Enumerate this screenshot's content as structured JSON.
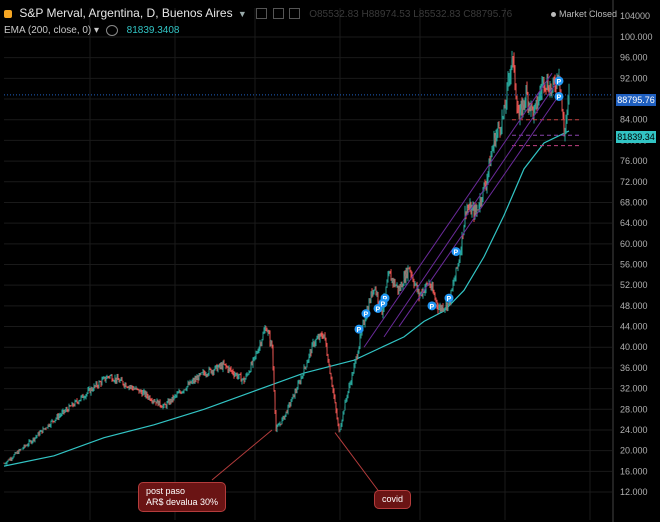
{
  "header": {
    "symbol_title": "S&P Merval, Argentina, D, Buenos Aires",
    "ohlc": "O85532.83 H88974.53 L85532.83 C88795.76",
    "market_status": "Market Closed"
  },
  "indicator": {
    "label": "EMA (200, close, 0)",
    "value": "81839.3408"
  },
  "price_labels": {
    "last_price": "88795.76",
    "ema": "81839.34"
  },
  "annotations": {
    "note1_line1": "post paso",
    "note1_line2": "AR$ devalua 30%",
    "note2": "covid"
  },
  "colors": {
    "up": "#26a69a",
    "down": "#ef5350",
    "ema": "#32c4c4",
    "last_price": "#1f5fbf",
    "marker": "#2196f3",
    "annotation_bg": "#6a1414"
  },
  "chart_data": {
    "type": "line",
    "title": "S&P Merval, Argentina, D, Buenos Aires",
    "y_axis_ticks": [
      100000,
      96000,
      92000,
      88000,
      84000,
      80000,
      76000,
      72000,
      68000,
      64000,
      60000,
      56000,
      52000,
      48000,
      44000,
      40000,
      36000,
      32000,
      28000,
      24000,
      20000,
      16000,
      12000
    ],
    "y_axis_top_label": "104000",
    "ylim": [
      12000,
      104000
    ],
    "grid": true,
    "series": [
      {
        "name": "S&P Merval",
        "points": [
          [
            0,
            17500
          ],
          [
            25,
            21500
          ],
          [
            50,
            26000
          ],
          [
            70,
            29000
          ],
          [
            85,
            31500
          ],
          [
            105,
            34500
          ],
          [
            120,
            33000
          ],
          [
            140,
            31000
          ],
          [
            160,
            28500
          ],
          [
            180,
            32000
          ],
          [
            200,
            35000
          ],
          [
            220,
            36500
          ],
          [
            240,
            33500
          ],
          [
            250,
            37500
          ],
          [
            262,
            44000
          ],
          [
            268,
            40000
          ],
          [
            272,
            24000
          ],
          [
            280,
            26500
          ],
          [
            295,
            33000
          ],
          [
            310,
            41000
          ],
          [
            320,
            42500
          ],
          [
            328,
            33000
          ],
          [
            335,
            23500
          ],
          [
            342,
            30000
          ],
          [
            350,
            36000
          ],
          [
            360,
            45000
          ],
          [
            370,
            52000
          ],
          [
            378,
            47000
          ],
          [
            385,
            54000
          ],
          [
            395,
            51000
          ],
          [
            405,
            55500
          ],
          [
            415,
            50000
          ],
          [
            425,
            52500
          ],
          [
            435,
            47500
          ],
          [
            445,
            48500
          ],
          [
            455,
            57000
          ],
          [
            462,
            67000
          ],
          [
            472,
            66000
          ],
          [
            482,
            72000
          ],
          [
            490,
            80000
          ],
          [
            500,
            85000
          ],
          [
            508,
            96500
          ],
          [
            515,
            84000
          ],
          [
            522,
            89000
          ],
          [
            530,
            85000
          ],
          [
            540,
            92000
          ],
          [
            548,
            89500
          ],
          [
            555,
            93500
          ],
          [
            560,
            81000
          ],
          [
            565,
            88800
          ]
        ]
      },
      {
        "name": "EMA (200, close, 0)",
        "points": [
          [
            0,
            17000
          ],
          [
            50,
            19000
          ],
          [
            100,
            22500
          ],
          [
            150,
            25000
          ],
          [
            200,
            28000
          ],
          [
            250,
            31500
          ],
          [
            300,
            35000
          ],
          [
            350,
            37500
          ],
          [
            400,
            42000
          ],
          [
            420,
            45000
          ],
          [
            440,
            47000
          ],
          [
            460,
            51000
          ],
          [
            480,
            57500
          ],
          [
            500,
            65500
          ],
          [
            520,
            74500
          ],
          [
            540,
            79500
          ],
          [
            565,
            81839
          ]
        ]
      }
    ]
  }
}
